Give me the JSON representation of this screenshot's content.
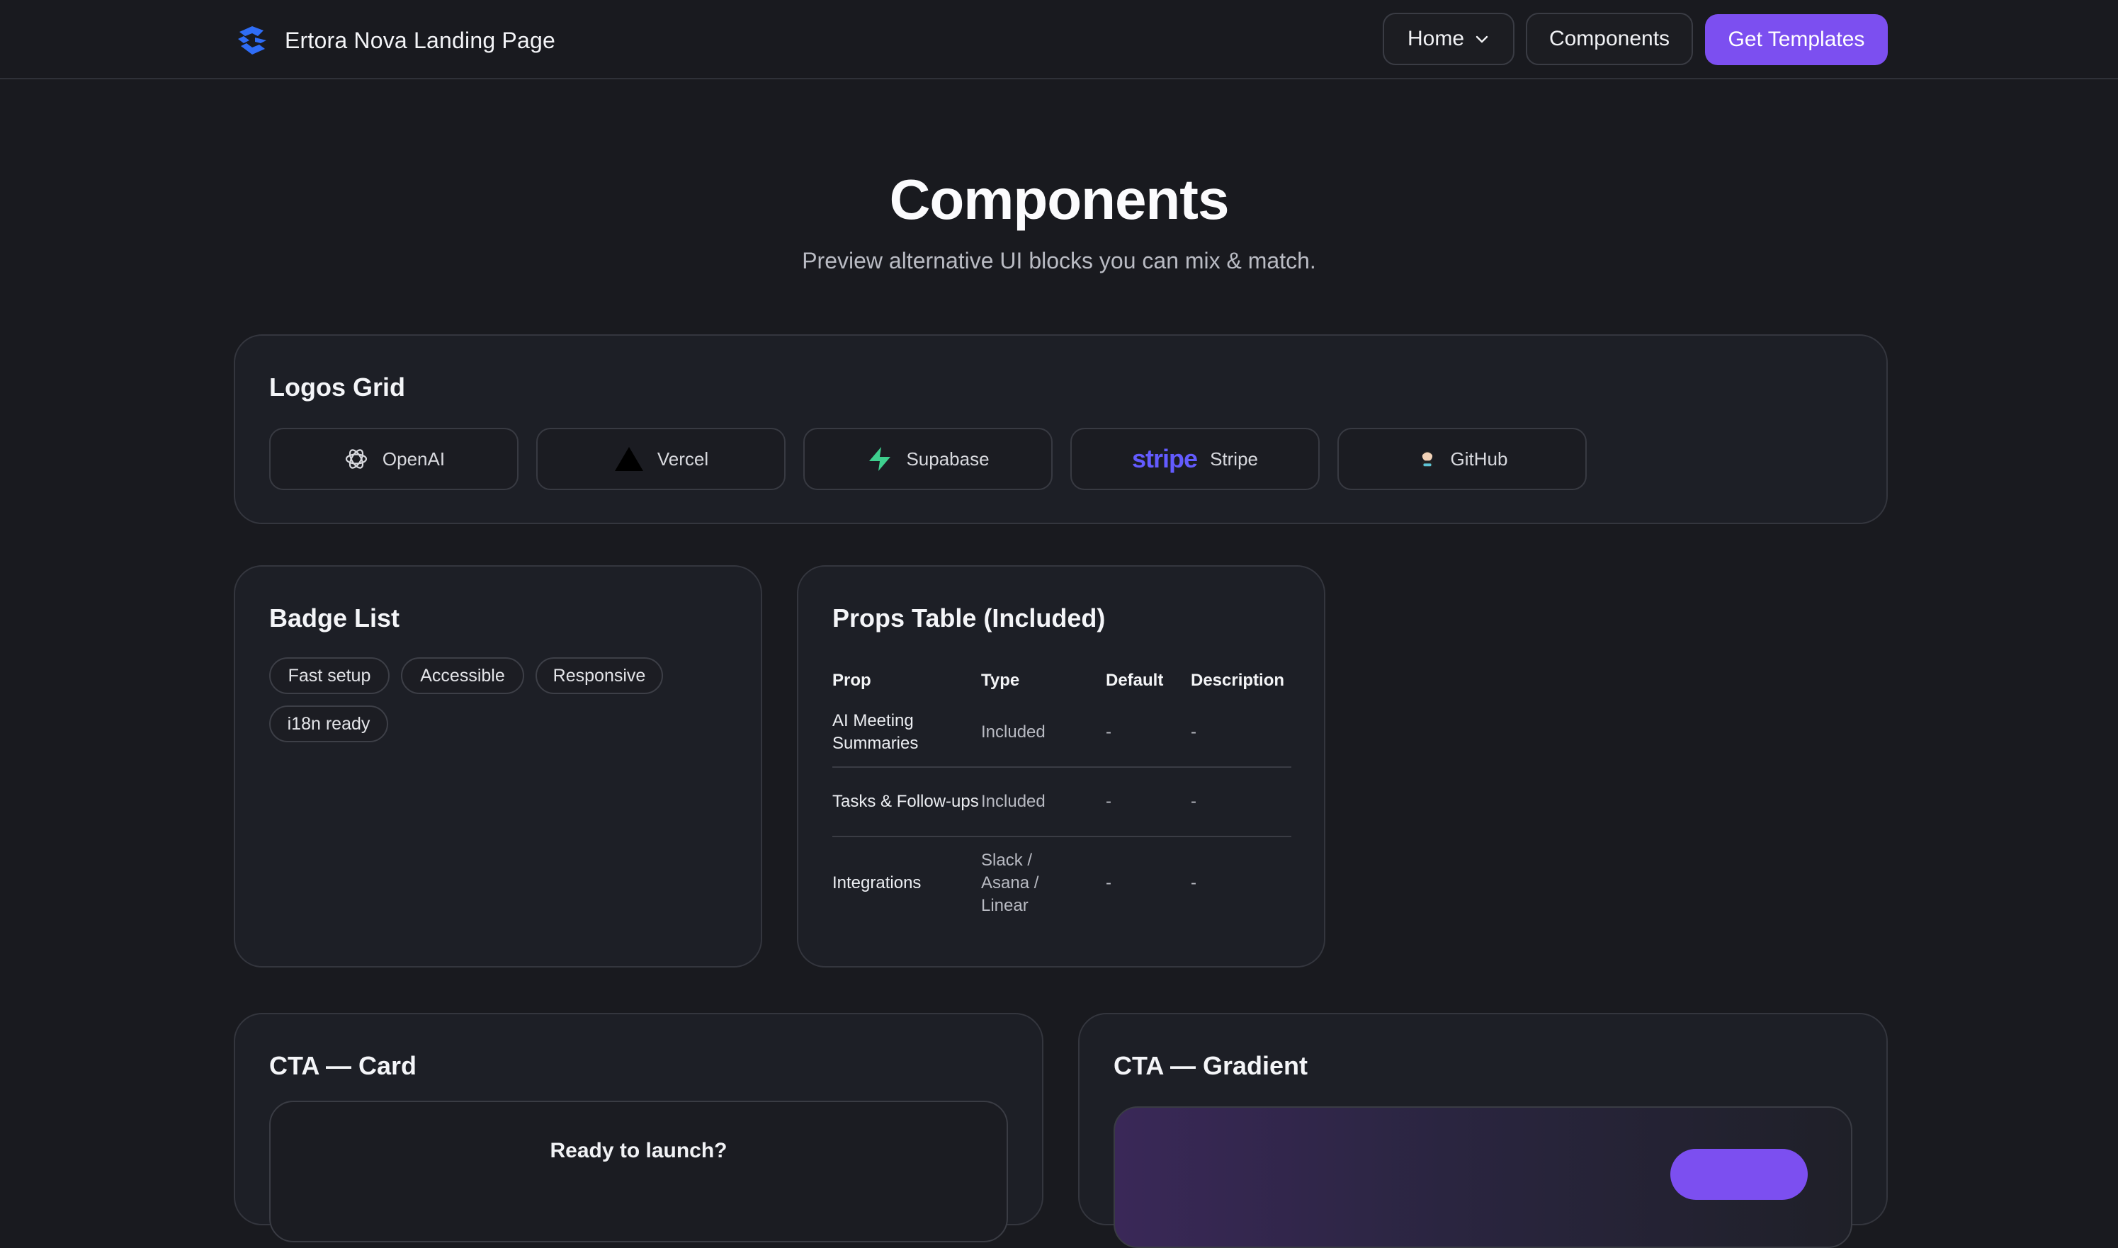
{
  "header": {
    "brand": "Ertora Nova Landing Page",
    "nav": {
      "home": "Home",
      "components": "Components",
      "cta": "Get Templates"
    }
  },
  "hero": {
    "title": "Components",
    "subtitle": "Preview alternative UI blocks you can mix & match."
  },
  "logos_grid": {
    "title": "Logos Grid",
    "items": [
      {
        "label": "OpenAI",
        "icon": "openai-logo-icon"
      },
      {
        "label": "Vercel",
        "icon": "vercel-logo-icon"
      },
      {
        "label": "Supabase",
        "icon": "supabase-logo-icon"
      },
      {
        "label": "Stripe",
        "icon": "stripe-logo-icon",
        "wordmark": "stripe"
      },
      {
        "label": "GitHub",
        "icon": "github-logo-icon"
      }
    ]
  },
  "badge_list": {
    "title": "Badge List",
    "badges": [
      "Fast setup",
      "Accessible",
      "Responsive",
      "i18n ready"
    ]
  },
  "props_table": {
    "title": "Props Table (Included)",
    "columns": [
      "Prop",
      "Type",
      "Default",
      "Description"
    ],
    "rows": [
      {
        "prop": "AI Meeting Summaries",
        "type": "Included",
        "default": "-",
        "description": "-"
      },
      {
        "prop": "Tasks & Follow-ups",
        "type": "Included",
        "default": "-",
        "description": "-"
      },
      {
        "prop": "Integrations",
        "type": "Slack / Asana / Linear",
        "default": "-",
        "description": "-"
      }
    ]
  },
  "cta_card": {
    "title": "CTA — Card",
    "inner_title": "Ready to launch?"
  },
  "cta_gradient": {
    "title": "CTA — Gradient"
  },
  "colors": {
    "background": "#191a1f",
    "card": "#1d1f26",
    "accent": "#7c4ff0",
    "brand_logo": "#2f6df6",
    "supabase": "#3ecf8e",
    "stripe": "#635bff"
  }
}
